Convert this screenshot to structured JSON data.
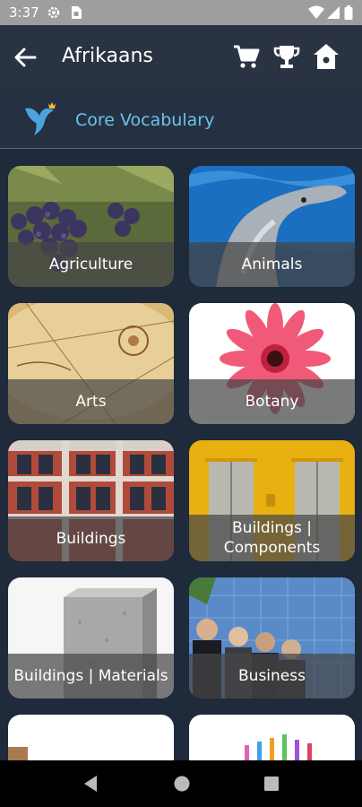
{
  "status_bar": {
    "time": "3:37",
    "icons": [
      "settings-gear-icon",
      "sim-card-icon",
      "wifi-icon",
      "cellular-signal-icon",
      "battery-icon"
    ]
  },
  "app_bar": {
    "title": "Afrikaans",
    "back_icon": "arrow-left-icon",
    "actions": [
      "cart-icon",
      "trophy-icon",
      "home-icon"
    ]
  },
  "header": {
    "title": "Core Vocabulary",
    "logo_icon": "bird-crown-logo"
  },
  "categories": [
    {
      "label": "Agriculture"
    },
    {
      "label": "Animals"
    },
    {
      "label": "Arts"
    },
    {
      "label": "Botany"
    },
    {
      "label": "Buildings"
    },
    {
      "label": "Buildings | Components"
    },
    {
      "label": "Buildings | Materials"
    },
    {
      "label": "Business"
    }
  ],
  "nav_bar": {
    "buttons": [
      "back-triangle-icon",
      "home-circle-icon",
      "recents-square-icon"
    ]
  },
  "colors": {
    "background": "#1f2a3a",
    "app_bar": "#2a3342",
    "accent": "#6ec1ea",
    "status_bar": "#9e9e9e"
  }
}
